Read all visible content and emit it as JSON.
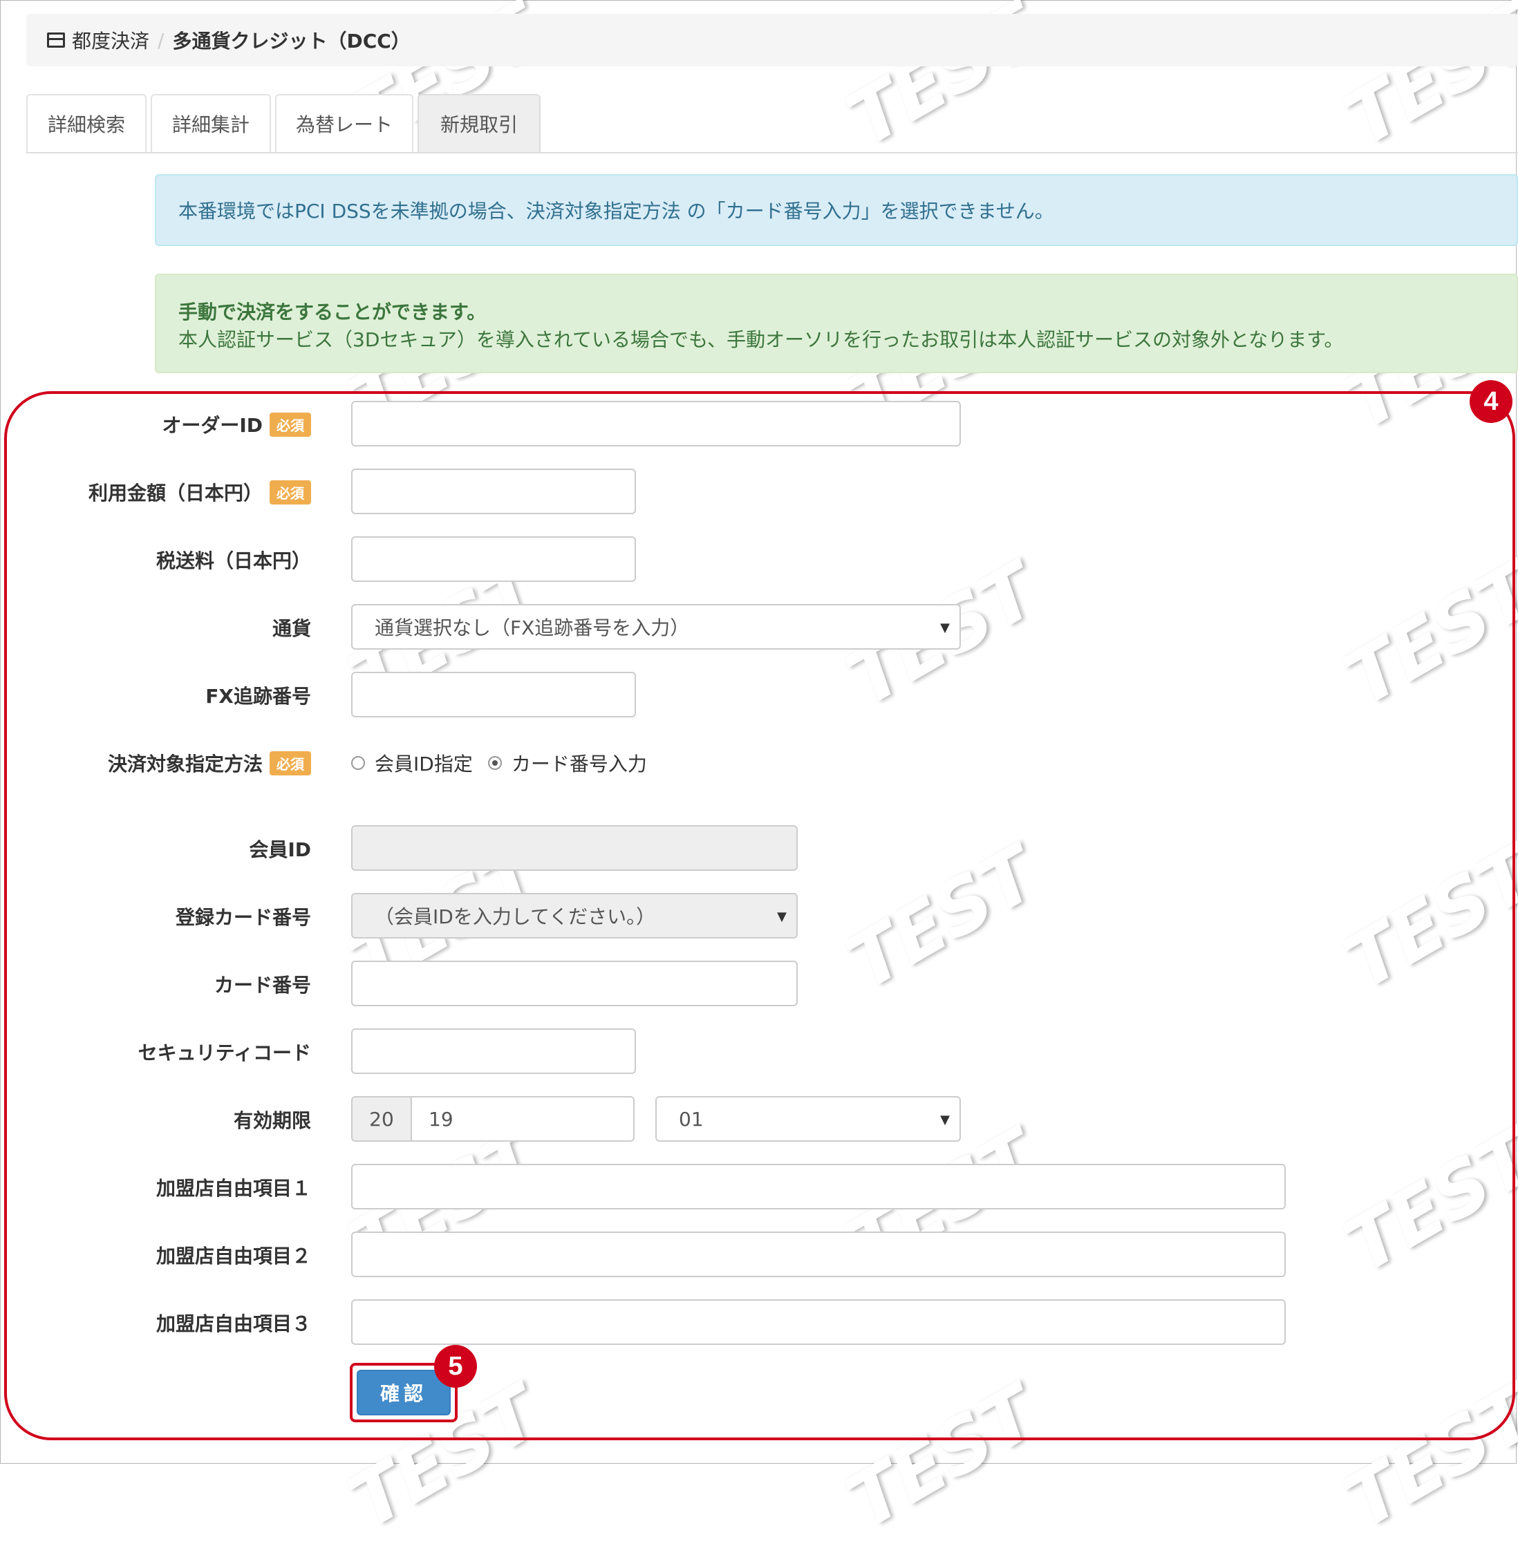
{
  "breadcrumb": {
    "icon": "credit-card-icon",
    "parent": "都度決済",
    "separator": "/",
    "current": "多通貨クレジット（DCC）"
  },
  "tabs": [
    {
      "label": "詳細検索",
      "active": false
    },
    {
      "label": "詳細集計",
      "active": false
    },
    {
      "label": "為替レート",
      "active": false
    },
    {
      "label": "新規取引",
      "active": true
    }
  ],
  "alerts": {
    "info": "本番環境ではPCI DSSを未準拠の場合、決済対象指定方法 の「カード番号入力」を選択できません。",
    "success_title": "手動で決済をすることができます。",
    "success_body": "本人認証サービス（3Dセキュア）を導入されている場合でも、手動オーソリを行ったお取引は本人認証サービスの対象外となります。"
  },
  "form": {
    "required_badge": "必須",
    "order_id": {
      "label": "オーダーID",
      "value": ""
    },
    "amount": {
      "label": "利用金額（日本円）",
      "value": ""
    },
    "tax": {
      "label": "税送料（日本円）",
      "value": ""
    },
    "currency": {
      "label": "通貨",
      "selected": "通貨選択なし（FX追跡番号を入力）"
    },
    "fx_tracking": {
      "label": "FX追跡番号",
      "value": ""
    },
    "payment_target": {
      "label": "決済対象指定方法",
      "options": [
        "会員ID指定",
        "カード番号入力"
      ],
      "selected": "カード番号入力"
    },
    "member_id": {
      "label": "会員ID",
      "value": ""
    },
    "registered_card": {
      "label": "登録カード番号",
      "selected": "（会員IDを入力してください。）"
    },
    "card_number": {
      "label": "カード番号",
      "value": ""
    },
    "security_code": {
      "label": "セキュリティコード",
      "value": ""
    },
    "expiry": {
      "label": "有効期限",
      "year_prefix": "20",
      "year": "19",
      "month": "01"
    },
    "free1": {
      "label": "加盟店自由項目１",
      "value": ""
    },
    "free2": {
      "label": "加盟店自由項目２",
      "value": ""
    },
    "free3": {
      "label": "加盟店自由項目３",
      "value": ""
    },
    "confirm_label": "確認"
  },
  "annotations": {
    "form_marker": "4",
    "confirm_marker": "5",
    "highlight_color": "#d0021b"
  },
  "watermark_text": "TEST",
  "colors": {
    "info_bg": "#d9edf7",
    "info_text": "#31708f",
    "success_bg": "#dff0d8",
    "success_text": "#3c763d",
    "required_badge": "#f0ad4e",
    "primary_button": "#428bca"
  }
}
